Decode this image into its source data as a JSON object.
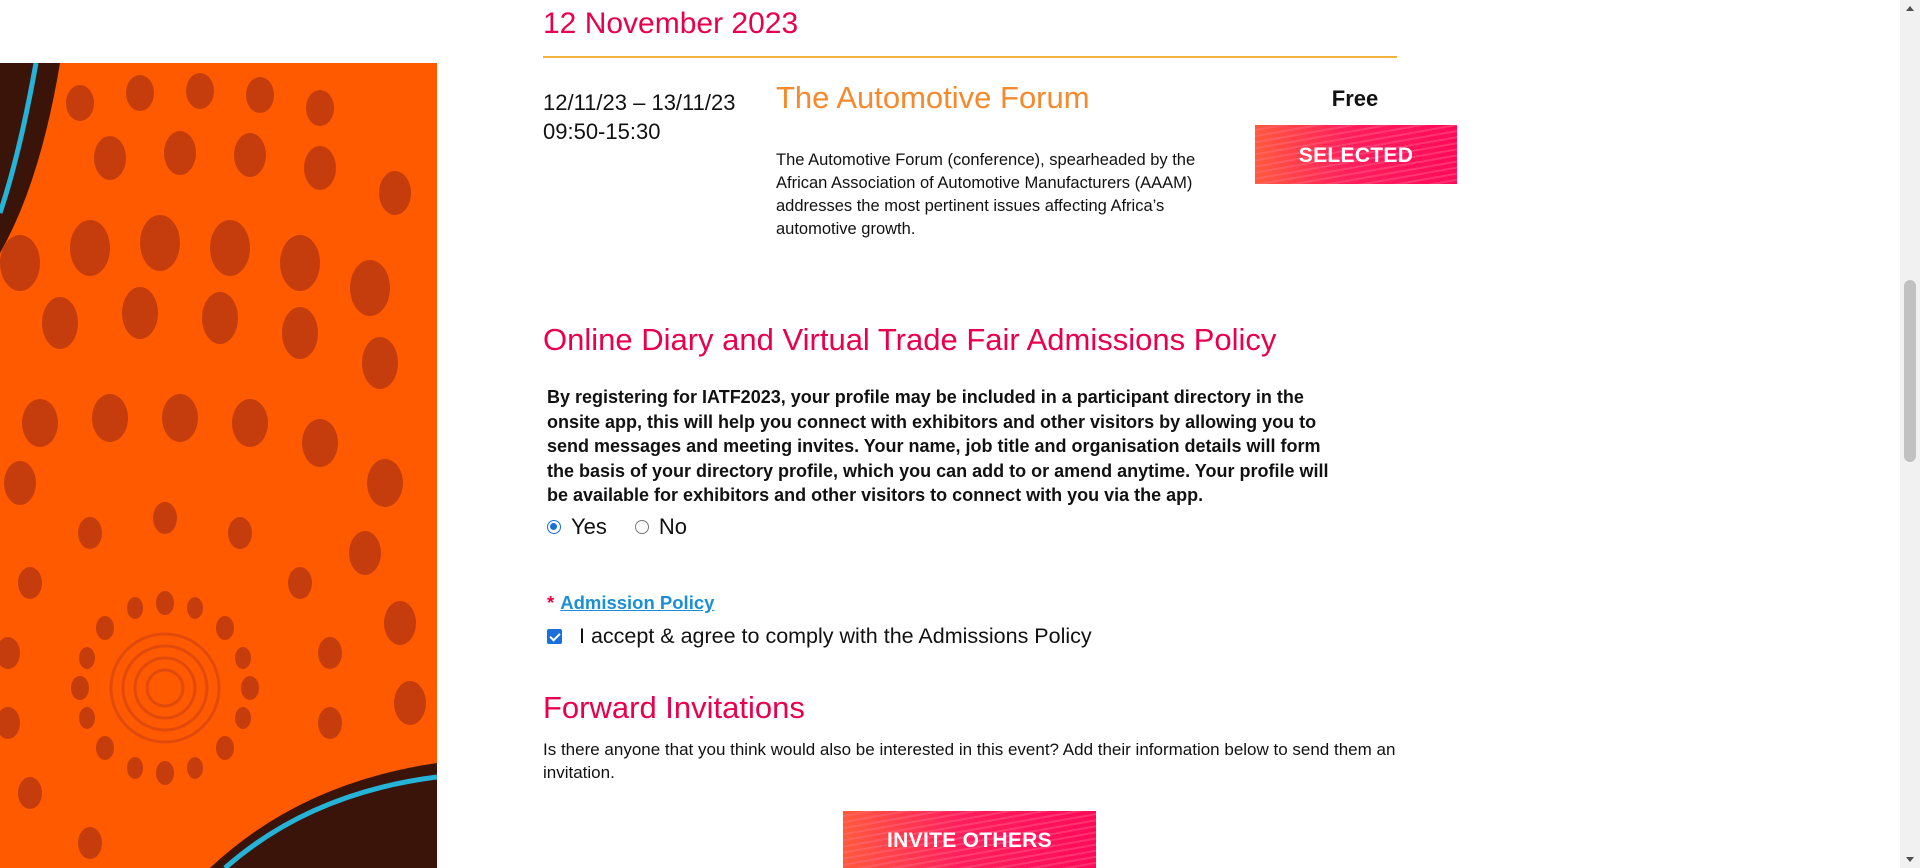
{
  "event_day": {
    "date_heading": "12 November 2023"
  },
  "session": {
    "date_range": "12/11/23 – 13/11/23",
    "time_range": "09:50-15:30",
    "title": "The Automotive Forum",
    "description": "The Automotive Forum (conference), spearheaded by the African Association of Automotive Manufacturers (AAAM) addresses the most pertinent issues affecting Africa’s automotive growth.",
    "price": "Free",
    "button_label": "SELECTED"
  },
  "policy": {
    "heading": "Online Diary and Virtual Trade Fair Admissions Policy",
    "body": "By registering for IATF2023, your profile may be included in a participant directory in the onsite app, this will help you connect with exhibitors and other visitors by allowing you to send messages and meeting invites. Your name, job title and organisation details will form the basis of your directory profile, which you can add to or amend anytime. Your profile will be available for exhibitors and other visitors to connect with you via the app.",
    "options": [
      {
        "label": "Yes",
        "checked": true
      },
      {
        "label": "No",
        "checked": false
      }
    ],
    "required_marker": "*",
    "admission_link_label": "Admission Policy",
    "accept_label": "I accept & agree to comply with the Admissions Policy",
    "accept_checked": true
  },
  "forward": {
    "heading": "Forward Invitations",
    "body": "Is there anyone that you think would also be interested in this event? Add their information below to send them an invitation.",
    "button_label": "INVITE OTHERS"
  },
  "colors": {
    "accent_pink": "#e8004d",
    "accent_orange": "#f5892c",
    "rule_gold": "#f2b43a",
    "link_blue": "#1b8fd6",
    "artwork_orange": "#ff5a00",
    "artwork_dots": "#c53d0c"
  }
}
